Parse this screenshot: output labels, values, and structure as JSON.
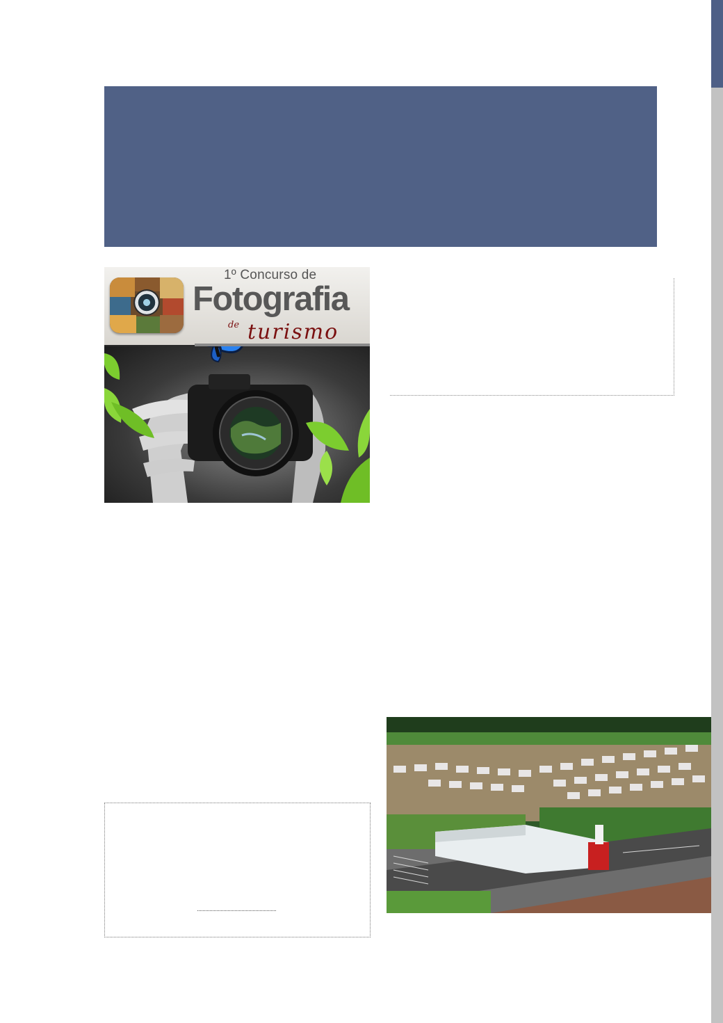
{
  "page": {
    "background": "#ffffff",
    "accent_color": "#506186",
    "scrollbar_track_color": "#c2c2c2",
    "scrollbar_thumb_color": "#4e5f86"
  },
  "poster": {
    "line1": "1º Concurso de",
    "line2": "Fotografia",
    "line3": "de",
    "line4": "turismo",
    "icons": [
      "camera-icon",
      "butterfly-icon",
      "leaf-icon"
    ]
  },
  "aerial_photo": {
    "subject": "housing-development-aerial"
  }
}
